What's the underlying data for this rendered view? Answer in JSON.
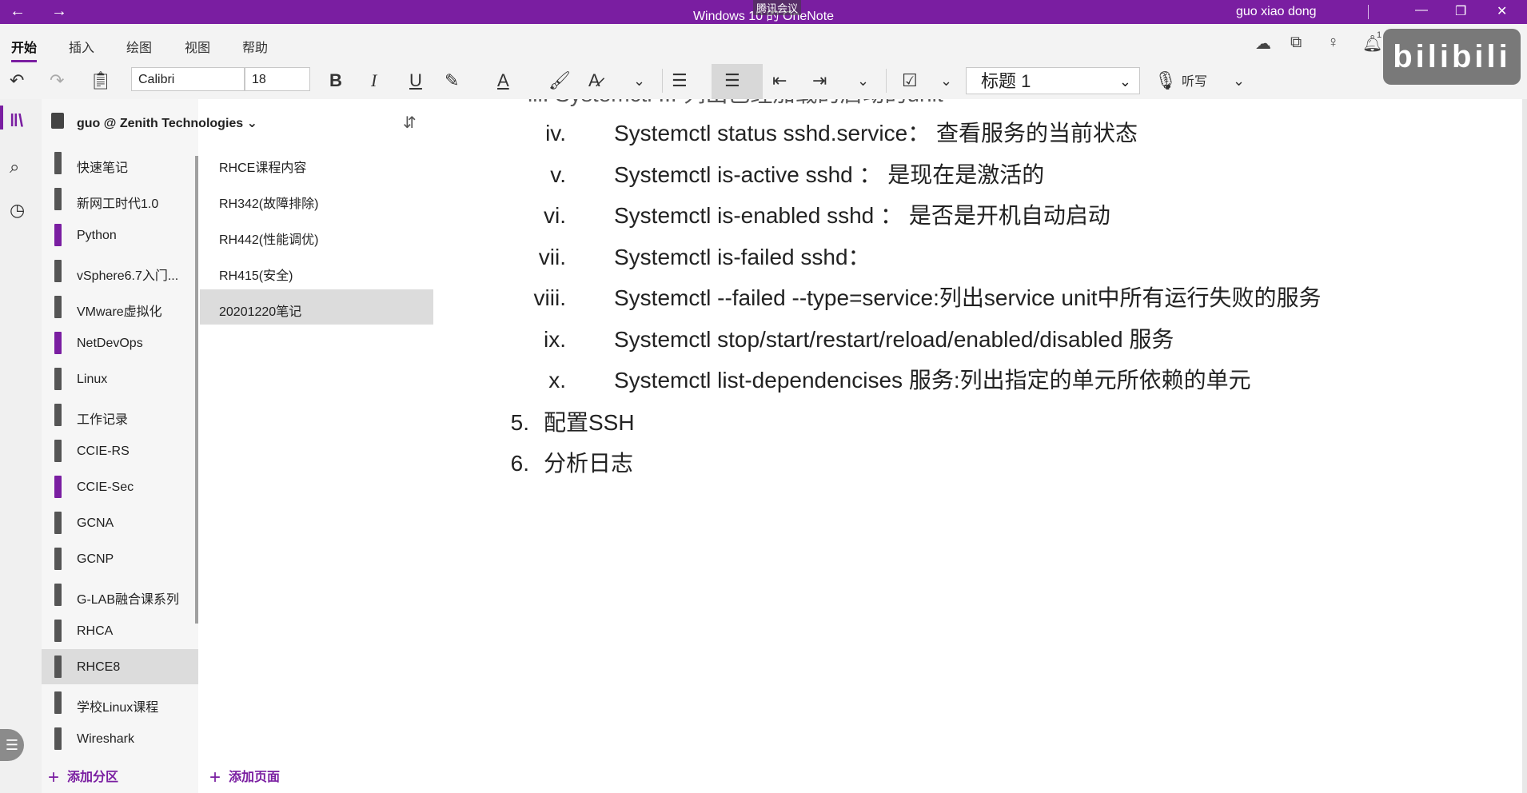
{
  "titlebar": {
    "back": "←",
    "forward": "→",
    "title": "Windows 10 的 OneNote",
    "meeting_overlay": "腾讯会议",
    "user": "guo xiao dong",
    "minimize": "—",
    "restore": "❐",
    "close": "✕"
  },
  "menu": {
    "tabs": [
      "开始",
      "插入",
      "绘图",
      "视图",
      "帮助"
    ],
    "badge": "1"
  },
  "toolbar": {
    "font_name": "Calibri",
    "font_size": "18",
    "bold": "B",
    "italic": "I",
    "underline": "U",
    "style": "标题 1",
    "dictate": "听写",
    "chevron": "⌄"
  },
  "notebook": {
    "name": "guo @ Zenith Technologies",
    "chevron": "⌄"
  },
  "sections": [
    {
      "label": "快速笔记",
      "color": "gray"
    },
    {
      "label": "新网工时代1.0",
      "color": "gray"
    },
    {
      "label": "Python",
      "color": "purple"
    },
    {
      "label": "vSphere6.7入门...",
      "color": "gray"
    },
    {
      "label": "VMware虚拟化",
      "color": "gray"
    },
    {
      "label": "NetDevOps",
      "color": "purple"
    },
    {
      "label": "Linux",
      "color": "gray"
    },
    {
      "label": "工作记录",
      "color": "gray"
    },
    {
      "label": "CCIE-RS",
      "color": "gray"
    },
    {
      "label": "CCIE-Sec",
      "color": "purple"
    },
    {
      "label": "GCNA",
      "color": "gray"
    },
    {
      "label": "GCNP",
      "color": "gray"
    },
    {
      "label": "G-LAB融合课系列",
      "color": "gray"
    },
    {
      "label": "RHCA",
      "color": "gray"
    },
    {
      "label": "RHCE8",
      "color": "gray",
      "selected": true
    },
    {
      "label": "学校Linux课程",
      "color": "gray"
    },
    {
      "label": "Wireshark",
      "color": "gray"
    }
  ],
  "pages": [
    {
      "label": "RHCE课程内容"
    },
    {
      "label": "RH342(故障排除)"
    },
    {
      "label": "RH442(性能调优)"
    },
    {
      "label": "RH415(安全)"
    },
    {
      "label": "20201220笔记",
      "selected": true
    }
  ],
  "footer": {
    "add_section": "添加分区",
    "add_page": "添加页面"
  },
  "content": {
    "clipped_top": "iii.  Systemctl ...  列出已经加载的启动的unit",
    "lines": [
      {
        "num": "iv.",
        "text": "Systemctl status sshd.service：  查看服务的当前状态"
      },
      {
        "num": "v.",
        "text": "Systemctl is-active sshd  ：  是现在是激活的"
      },
      {
        "num": "vi.",
        "text": "Systemctl is-enabled sshd ：  是否是开机自动启动"
      },
      {
        "num": "vii.",
        "text": "Systemctl is-failed sshd："
      },
      {
        "num": "viii.",
        "text": "Systemctl --failed --type=service:列出service unit中所有运行失败的服务"
      },
      {
        "num": "ix.",
        "text": "Systemctl  stop/start/restart/reload/enabled/disabled  服务"
      },
      {
        "num": "x.",
        "text": "Systemctl list-dependencises 服务:列出指定的单元所依赖的单元"
      }
    ],
    "outer": [
      {
        "num": "5.",
        "text": "配置SSH"
      },
      {
        "num": "6.",
        "text": "分析日志"
      }
    ]
  },
  "watermark": "bilibili"
}
